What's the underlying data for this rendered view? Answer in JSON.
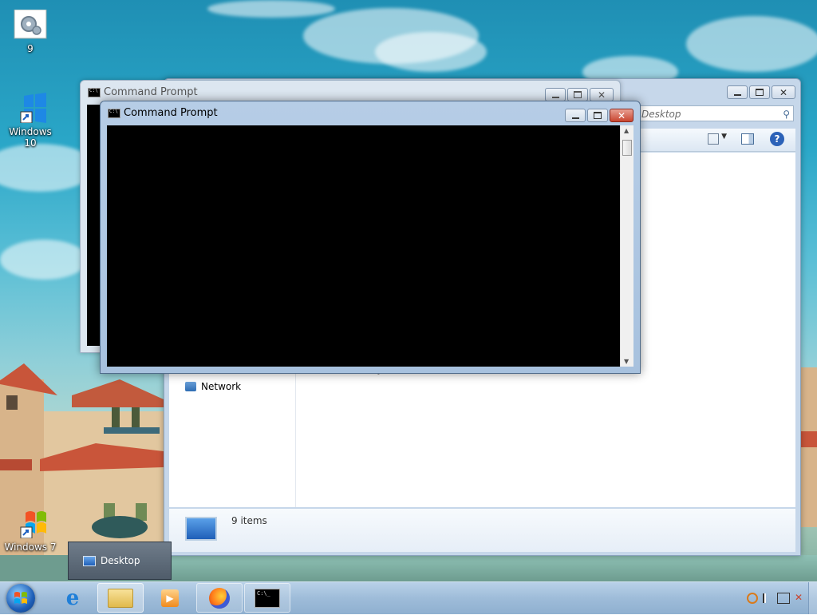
{
  "desktop": {
    "icons": [
      {
        "label": "9"
      },
      {
        "label": "Windows 10"
      },
      {
        "label": "Windows 7"
      }
    ]
  },
  "explorer": {
    "search_placeholder": "Desktop",
    "nav_network": "Network",
    "partial_text": "10 bytes",
    "status_items": "9 items"
  },
  "cmd_back": {
    "title": "Command Prompt"
  },
  "cmd_front": {
    "title": "Command Prompt"
  },
  "thumbnail": {
    "label": "Desktop"
  },
  "colors": {
    "accent": "#4f6b8a",
    "close": "#c9452f"
  }
}
